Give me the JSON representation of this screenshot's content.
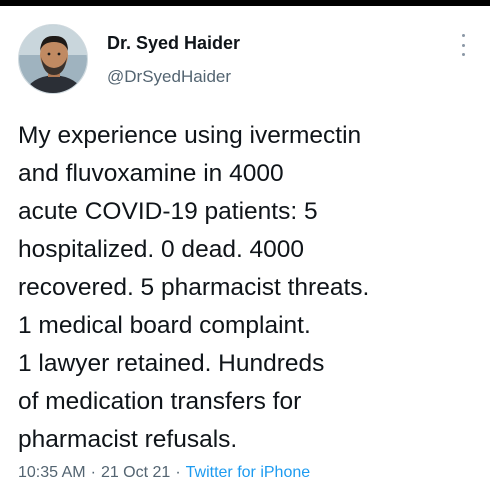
{
  "tweet": {
    "author": {
      "display_name": "Dr. Syed Haider",
      "handle": "@DrSyedHaider",
      "avatar_icon": "profile-photo-avatar"
    },
    "menu_icon": "more-vertical-icon",
    "text": "My experience using ivermectin\nand fluvoxamine in 4000\nacute COVID-19 patients: 5\nhospitalized. 0 dead. 4000\nrecovered. 5 pharmacist threats.\n1 medical board complaint.\n1 lawyer retained. Hundreds\nof medication transfers for\npharmacist refusals.",
    "time": "10:35 AM",
    "separator": "·",
    "date": "21 Oct 21",
    "source": "Twitter for iPhone"
  },
  "colors": {
    "text_primary": "#0f1419",
    "text_secondary": "#536471",
    "link": "#1d9bf0",
    "background": "#ffffff"
  }
}
